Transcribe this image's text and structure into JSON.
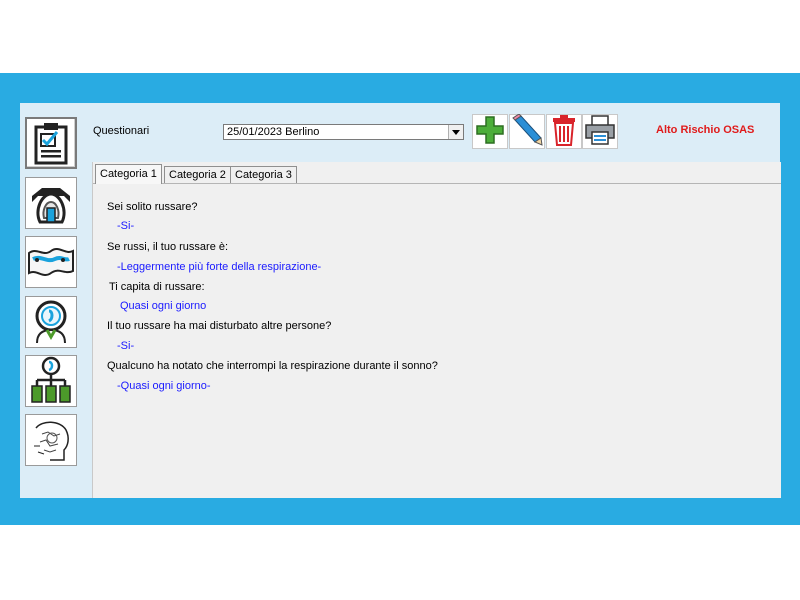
{
  "toolbar": {
    "label": "Questionari",
    "selected": "25/01/2023 Berlino",
    "risk": "Alto Rischio OSAS"
  },
  "tabs": [
    "Categoria 1",
    "Categoria 2",
    "Categoria 3"
  ],
  "qa": [
    {
      "q": "Sei solito russare?",
      "a": "-Si-"
    },
    {
      "q": "Se russi, il tuo russare è:",
      "a": "-Leggermente più forte della respirazione-"
    },
    {
      "q": "Ti capita di russare:",
      "a": "Quasi ogni giorno"
    },
    {
      "q": "Il tuo russare ha mai disturbato altre persone?",
      "a": "-Si-"
    },
    {
      "q": "Qualcuno ha notato che interrompi la respirazione durante il sonno?",
      "a": "-Quasi ogni giorno-"
    }
  ],
  "icons": {
    "sidebar": [
      "questionnaire-icon",
      "cpap-mask-icon",
      "airway-icon",
      "ent-exam-icon",
      "diagnosis-tree-icon",
      "cephalometry-icon"
    ],
    "toolbar": [
      "add-icon",
      "edit-pencil-icon",
      "delete-trash-icon",
      "print-icon"
    ]
  },
  "colors": {
    "frame": "#29abe2",
    "window": "#dcedf7",
    "risk": "#e01b1b",
    "answer": "#1a1aff"
  }
}
